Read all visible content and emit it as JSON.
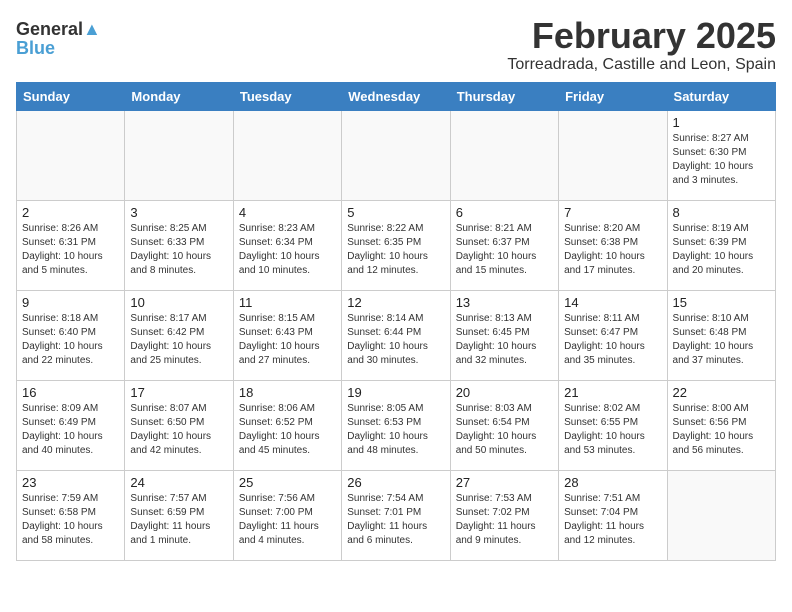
{
  "logo": {
    "line1": "General",
    "line2": "Blue"
  },
  "title": "February 2025",
  "subtitle": "Torreadrada, Castille and Leon, Spain",
  "days_of_week": [
    "Sunday",
    "Monday",
    "Tuesday",
    "Wednesday",
    "Thursday",
    "Friday",
    "Saturday"
  ],
  "weeks": [
    [
      {
        "day": null
      },
      {
        "day": null
      },
      {
        "day": null
      },
      {
        "day": null
      },
      {
        "day": null
      },
      {
        "day": null
      },
      {
        "day": "1",
        "sunrise": "Sunrise: 8:27 AM",
        "sunset": "Sunset: 6:30 PM",
        "daylight": "Daylight: 10 hours and 3 minutes."
      }
    ],
    [
      {
        "day": "2",
        "sunrise": "Sunrise: 8:26 AM",
        "sunset": "Sunset: 6:31 PM",
        "daylight": "Daylight: 10 hours and 5 minutes."
      },
      {
        "day": "3",
        "sunrise": "Sunrise: 8:25 AM",
        "sunset": "Sunset: 6:33 PM",
        "daylight": "Daylight: 10 hours and 8 minutes."
      },
      {
        "day": "4",
        "sunrise": "Sunrise: 8:23 AM",
        "sunset": "Sunset: 6:34 PM",
        "daylight": "Daylight: 10 hours and 10 minutes."
      },
      {
        "day": "5",
        "sunrise": "Sunrise: 8:22 AM",
        "sunset": "Sunset: 6:35 PM",
        "daylight": "Daylight: 10 hours and 12 minutes."
      },
      {
        "day": "6",
        "sunrise": "Sunrise: 8:21 AM",
        "sunset": "Sunset: 6:37 PM",
        "daylight": "Daylight: 10 hours and 15 minutes."
      },
      {
        "day": "7",
        "sunrise": "Sunrise: 8:20 AM",
        "sunset": "Sunset: 6:38 PM",
        "daylight": "Daylight: 10 hours and 17 minutes."
      },
      {
        "day": "8",
        "sunrise": "Sunrise: 8:19 AM",
        "sunset": "Sunset: 6:39 PM",
        "daylight": "Daylight: 10 hours and 20 minutes."
      }
    ],
    [
      {
        "day": "9",
        "sunrise": "Sunrise: 8:18 AM",
        "sunset": "Sunset: 6:40 PM",
        "daylight": "Daylight: 10 hours and 22 minutes."
      },
      {
        "day": "10",
        "sunrise": "Sunrise: 8:17 AM",
        "sunset": "Sunset: 6:42 PM",
        "daylight": "Daylight: 10 hours and 25 minutes."
      },
      {
        "day": "11",
        "sunrise": "Sunrise: 8:15 AM",
        "sunset": "Sunset: 6:43 PM",
        "daylight": "Daylight: 10 hours and 27 minutes."
      },
      {
        "day": "12",
        "sunrise": "Sunrise: 8:14 AM",
        "sunset": "Sunset: 6:44 PM",
        "daylight": "Daylight: 10 hours and 30 minutes."
      },
      {
        "day": "13",
        "sunrise": "Sunrise: 8:13 AM",
        "sunset": "Sunset: 6:45 PM",
        "daylight": "Daylight: 10 hours and 32 minutes."
      },
      {
        "day": "14",
        "sunrise": "Sunrise: 8:11 AM",
        "sunset": "Sunset: 6:47 PM",
        "daylight": "Daylight: 10 hours and 35 minutes."
      },
      {
        "day": "15",
        "sunrise": "Sunrise: 8:10 AM",
        "sunset": "Sunset: 6:48 PM",
        "daylight": "Daylight: 10 hours and 37 minutes."
      }
    ],
    [
      {
        "day": "16",
        "sunrise": "Sunrise: 8:09 AM",
        "sunset": "Sunset: 6:49 PM",
        "daylight": "Daylight: 10 hours and 40 minutes."
      },
      {
        "day": "17",
        "sunrise": "Sunrise: 8:07 AM",
        "sunset": "Sunset: 6:50 PM",
        "daylight": "Daylight: 10 hours and 42 minutes."
      },
      {
        "day": "18",
        "sunrise": "Sunrise: 8:06 AM",
        "sunset": "Sunset: 6:52 PM",
        "daylight": "Daylight: 10 hours and 45 minutes."
      },
      {
        "day": "19",
        "sunrise": "Sunrise: 8:05 AM",
        "sunset": "Sunset: 6:53 PM",
        "daylight": "Daylight: 10 hours and 48 minutes."
      },
      {
        "day": "20",
        "sunrise": "Sunrise: 8:03 AM",
        "sunset": "Sunset: 6:54 PM",
        "daylight": "Daylight: 10 hours and 50 minutes."
      },
      {
        "day": "21",
        "sunrise": "Sunrise: 8:02 AM",
        "sunset": "Sunset: 6:55 PM",
        "daylight": "Daylight: 10 hours and 53 minutes."
      },
      {
        "day": "22",
        "sunrise": "Sunrise: 8:00 AM",
        "sunset": "Sunset: 6:56 PM",
        "daylight": "Daylight: 10 hours and 56 minutes."
      }
    ],
    [
      {
        "day": "23",
        "sunrise": "Sunrise: 7:59 AM",
        "sunset": "Sunset: 6:58 PM",
        "daylight": "Daylight: 10 hours and 58 minutes."
      },
      {
        "day": "24",
        "sunrise": "Sunrise: 7:57 AM",
        "sunset": "Sunset: 6:59 PM",
        "daylight": "Daylight: 11 hours and 1 minute."
      },
      {
        "day": "25",
        "sunrise": "Sunrise: 7:56 AM",
        "sunset": "Sunset: 7:00 PM",
        "daylight": "Daylight: 11 hours and 4 minutes."
      },
      {
        "day": "26",
        "sunrise": "Sunrise: 7:54 AM",
        "sunset": "Sunset: 7:01 PM",
        "daylight": "Daylight: 11 hours and 6 minutes."
      },
      {
        "day": "27",
        "sunrise": "Sunrise: 7:53 AM",
        "sunset": "Sunset: 7:02 PM",
        "daylight": "Daylight: 11 hours and 9 minutes."
      },
      {
        "day": "28",
        "sunrise": "Sunrise: 7:51 AM",
        "sunset": "Sunset: 7:04 PM",
        "daylight": "Daylight: 11 hours and 12 minutes."
      },
      {
        "day": null
      }
    ]
  ]
}
